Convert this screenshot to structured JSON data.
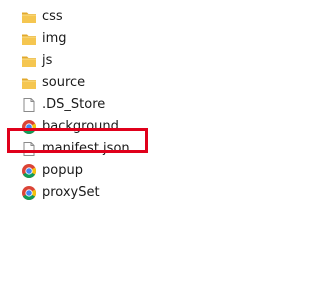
{
  "files": [
    {
      "name": "css",
      "icon": "folder-icon"
    },
    {
      "name": "img",
      "icon": "folder-icon"
    },
    {
      "name": "js",
      "icon": "folder-icon"
    },
    {
      "name": "source",
      "icon": "folder-icon"
    },
    {
      "name": ".DS_Store",
      "icon": "blank-file-icon"
    },
    {
      "name": "background",
      "icon": "chrome-html-icon"
    },
    {
      "name": "manifest.json",
      "icon": "blank-file-icon"
    },
    {
      "name": "popup",
      "icon": "chrome-html-icon"
    },
    {
      "name": "proxySet",
      "icon": "chrome-html-icon"
    }
  ],
  "highlight": {
    "target": "manifest.json",
    "color": "#e0001b"
  },
  "colors": {
    "folder": "#f5c650",
    "folder_dark": "#e2a92c",
    "chrome_red": "#db4437",
    "chrome_yellow": "#f4c20d",
    "chrome_green": "#0f9d58",
    "chrome_blue": "#4285f4"
  }
}
